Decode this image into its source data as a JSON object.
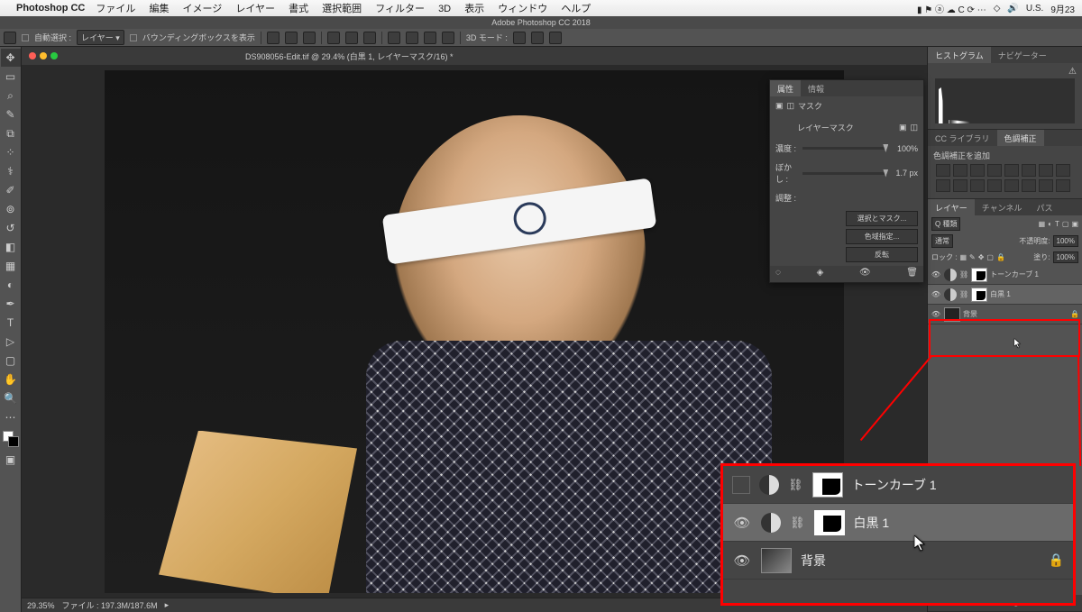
{
  "menubar": {
    "app": "Photoshop CC",
    "items": [
      "ファイル",
      "編集",
      "イメージ",
      "レイヤー",
      "書式",
      "選択範囲",
      "フィルター",
      "3D",
      "表示",
      "ウィンドウ",
      "ヘルプ"
    ],
    "right": {
      "input": "U.S.",
      "date": "9月23"
    }
  },
  "titlebar": "Adobe Photoshop CC 2018",
  "options": {
    "autoselect_label": "自動選択 :",
    "autoselect_mode": "レイヤー",
    "bbox_label": "バウンディングボックスを表示",
    "mode3d_label": "3D モード :"
  },
  "document": {
    "tab": "DS908056-Edit.tif @ 29.4% (白黒 1, レイヤーマスク/16) *"
  },
  "statusbar": {
    "zoom": "29.35%",
    "filesize": "ファイル : 197.3M/187.6M"
  },
  "properties": {
    "tab1": "属性",
    "tab2": "情報",
    "type_label": "マスク",
    "mask_label": "レイヤーマスク",
    "density_label": "濃度 :",
    "density_value": "100%",
    "feather_label": "ぼかし :",
    "feather_value": "1.7 px",
    "adjust_label": "調整 :",
    "btn_select": "選択とマスク...",
    "btn_color": "色域指定...",
    "btn_invert": "反転"
  },
  "panels": {
    "histogram_tab": "ヒストグラム",
    "navigator_tab": "ナビゲーター",
    "cclib_tab": "CC ライブラリ",
    "adjust_tab": "色調補正",
    "adjust_add": "色調補正を追加",
    "layers_tab": "レイヤー",
    "channels_tab": "チャンネル",
    "paths_tab": "パス",
    "blend_mode": "通常",
    "opacity_label": "不透明度:",
    "opacity_value": "100%",
    "lock_label": "ロック :",
    "fill_label": "塗り:",
    "fill_value": "100%",
    "kind": "Q 種類"
  },
  "layers": {
    "l1": "トーンカーブ 1",
    "l2": "白黒 1",
    "l3": "背景"
  }
}
